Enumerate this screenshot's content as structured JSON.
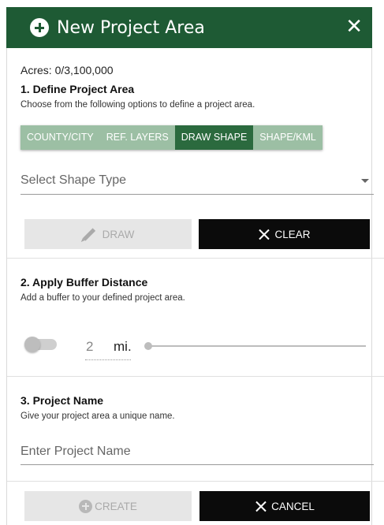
{
  "header": {
    "title": "New Project Area",
    "close": "✕"
  },
  "acres": "Acres: 0/3,100,000",
  "section1": {
    "heading": "1. Define Project Area",
    "description": "Choose from the following options to define a project area.",
    "tabs": [
      {
        "label": "COUNTY/CITY",
        "active": false
      },
      {
        "label": "REF. LAYERS",
        "active": false
      },
      {
        "label": "DRAW SHAPE",
        "active": true
      },
      {
        "label": "SHAPE/KML",
        "active": false
      }
    ],
    "shape_select_placeholder": "Select Shape Type",
    "draw_label": "DRAW",
    "clear_label": "CLEAR"
  },
  "section2": {
    "heading": "2. Apply Buffer Distance",
    "description": "Add a buffer to your defined project area.",
    "buffer_value": "2",
    "buffer_unit": "mi.",
    "toggle_on": false,
    "slider_fraction": 0
  },
  "section3": {
    "heading": "3. Project Name",
    "description": "Give your project area a unique name.",
    "name_placeholder": "Enter Project Name"
  },
  "footer": {
    "create_label": "CREATE",
    "cancel_label": "CANCEL"
  },
  "colors": {
    "header": "#1e5a34",
    "tab": "#9cbfa4",
    "tab_active": "#2b6a3e",
    "dark_button": "#0b0b0b",
    "disabled_button": "#e6e6e6"
  }
}
